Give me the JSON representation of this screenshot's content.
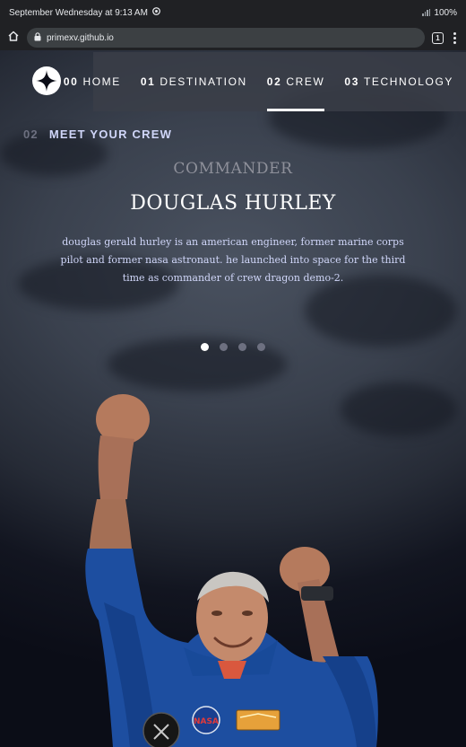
{
  "status_bar": {
    "time_text": "September Wednesday at 9:13 AM",
    "battery": "100%"
  },
  "browser": {
    "url": "primexv.github.io",
    "tab_count": "1"
  },
  "nav": {
    "items": [
      {
        "num": "00",
        "label": "HOME"
      },
      {
        "num": "01",
        "label": "DESTINATION"
      },
      {
        "num": "02",
        "label": "CREW"
      },
      {
        "num": "03",
        "label": "TECHNOLOGY"
      }
    ]
  },
  "page": {
    "subheading": {
      "num": "02",
      "text": "MEET YOUR CREW"
    },
    "role": "COMMANDER",
    "name": "DOUGLAS HURLEY",
    "bio": "douglas gerald hurley is an american engineer, former marine corps pilot and former nasa astronaut. he launched into space for the third time as commander of crew dragon demo-2."
  },
  "carousel": {
    "count": 4,
    "active": 1
  },
  "colors": {
    "background": "#0b0d17",
    "accent_text": "#d0d6f9",
    "muted": "#6d7080"
  }
}
